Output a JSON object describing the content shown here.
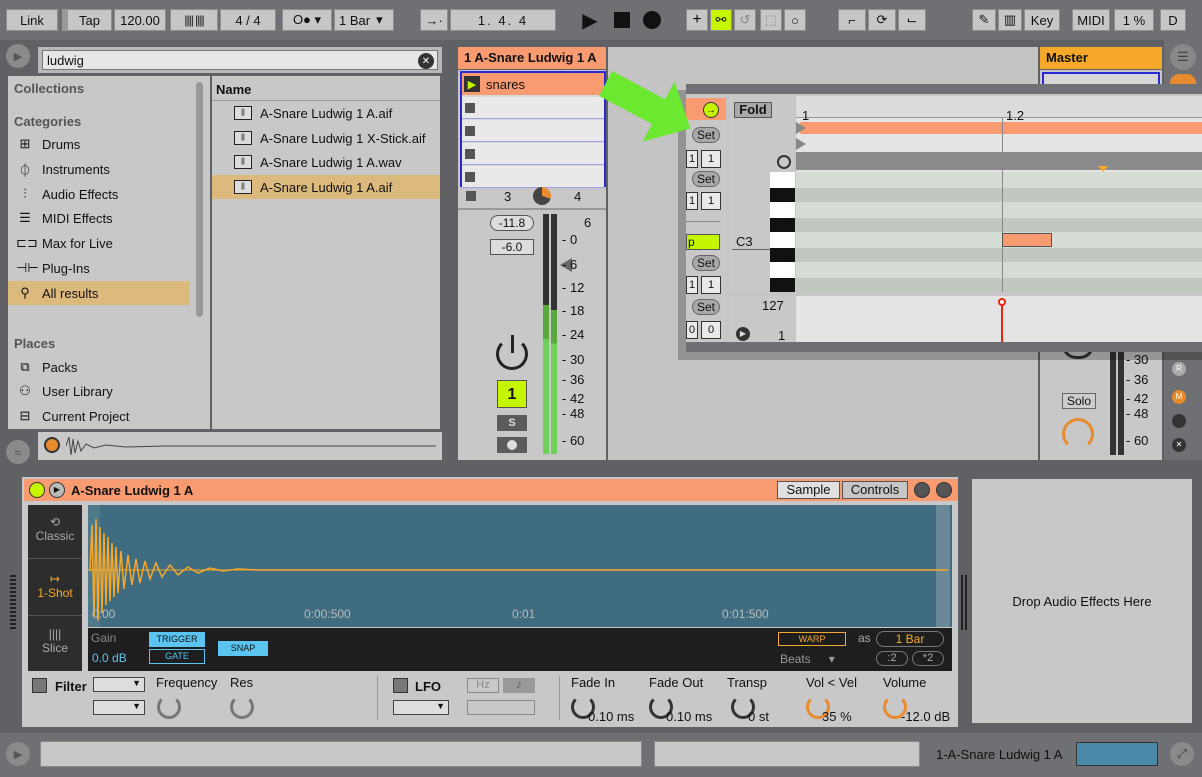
{
  "toolbar": {
    "link": "Link",
    "tap": "Tap",
    "tempo": "120.00",
    "signature": "4 / 4",
    "quantize": "1 Bar",
    "position": "1.  4.  4",
    "key": "Key",
    "midi": "MIDI",
    "cpu": "1 %",
    "d": "D"
  },
  "browser": {
    "search_value": "ludwig",
    "collections": "Collections",
    "categories_label": "Categories",
    "categories": [
      {
        "icon": "drums-icon",
        "label": "Drums"
      },
      {
        "icon": "instruments-icon",
        "label": "Instruments"
      },
      {
        "icon": "audio-effects-icon",
        "label": "Audio Effects"
      },
      {
        "icon": "midi-effects-icon",
        "label": "MIDI Effects"
      },
      {
        "icon": "max-icon",
        "label": "Max for Live"
      },
      {
        "icon": "plugins-icon",
        "label": "Plug-Ins"
      },
      {
        "icon": "search-icon",
        "label": "All results"
      }
    ],
    "places_label": "Places",
    "places": [
      {
        "icon": "packs-icon",
        "label": "Packs"
      },
      {
        "icon": "user-icon",
        "label": "User Library"
      },
      {
        "icon": "project-icon",
        "label": "Current Project"
      }
    ],
    "name_header": "Name",
    "files": [
      "A-Snare Ludwig 1 A.aif",
      "A-Snare Ludwig 1 X-Stick.aif",
      "A-Snare Ludwig 1 A.wav",
      "A-Snare Ludwig 1 A.aif"
    ]
  },
  "track": {
    "name": "1 A-Snare Ludwig 1 A",
    "clip": "snares",
    "send_a": "3",
    "send_b": "4",
    "vol1": "-11.8",
    "vol2": "-6.0",
    "scale": [
      "6",
      "0",
      "6",
      "12",
      "18",
      "24",
      "30",
      "36",
      "42",
      "48",
      "60"
    ],
    "number": "1",
    "solo": "S"
  },
  "master": {
    "name": "Master",
    "scale": [
      "30",
      "36",
      "42",
      "48",
      "60"
    ],
    "solo": "Solo",
    "rec_letters": [
      "R",
      "M"
    ]
  },
  "clip_editor": {
    "fold": "Fold",
    "set": "Set",
    "ruler": [
      "1",
      "1.2"
    ],
    "note": "C3",
    "vel_top": "127",
    "vel_bot": "1",
    "num_vals": [
      "1",
      "1",
      "1",
      "1",
      "1",
      "1",
      "0",
      "0"
    ],
    "loop_short": "p"
  },
  "device": {
    "title": "A-Snare Ludwig 1 A",
    "tab_sample": "Sample",
    "tab_controls": "Controls",
    "modes": [
      "Classic",
      "1-Shot",
      "Slice"
    ],
    "time_marks": [
      "0:00",
      "0:00:500",
      "0:01",
      "0:01:500"
    ],
    "gain_label": "Gain",
    "gain_value": "0.0 dB",
    "trigger": "TRIGGER",
    "gate": "GATE",
    "snap": "SNAP",
    "warp": "WARP",
    "as": "as",
    "bar": "1 Bar",
    "beats": "Beats",
    "half": ":2",
    "double": "*2",
    "filter": "Filter",
    "frequency": "Frequency",
    "res": "Res",
    "lfo": "LFO",
    "hz": "Hz",
    "params": [
      {
        "label": "Fade In",
        "value": "0.10 ms"
      },
      {
        "label": "Fade Out",
        "value": "0.10 ms"
      },
      {
        "label": "Transp",
        "value": "0 st"
      },
      {
        "label": "Vol < Vel",
        "value": "35 %"
      },
      {
        "label": "Volume",
        "value": "-12.0 dB"
      }
    ],
    "drop_text": "Drop Audio Effects Here"
  },
  "status": {
    "track_label": "1-A-Snare Ludwig 1 A"
  },
  "colors": {
    "accent": "#f89b71",
    "lime": "#c6f500",
    "waveform_bg": "#3f6c80",
    "waveform": "#f6a82a",
    "arrow": "#6be82f"
  }
}
